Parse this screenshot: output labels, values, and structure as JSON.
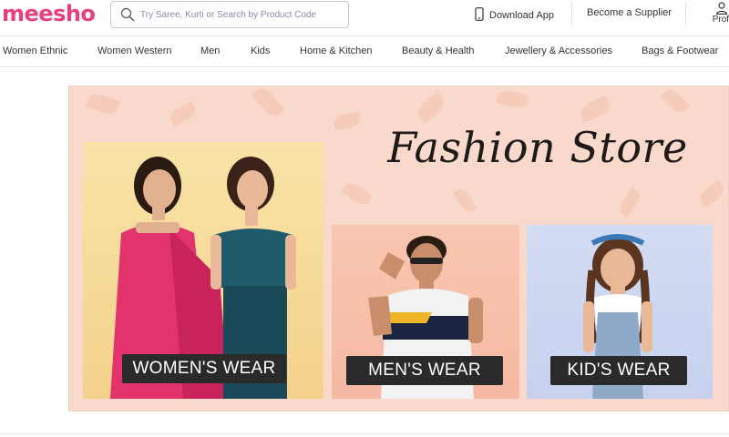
{
  "header": {
    "logo": "meesho",
    "search_placeholder": "Try Saree, Kurti or Search by Product Code",
    "download_app": "Download App",
    "become_supplier": "Become a Supplier",
    "profile": "Profi"
  },
  "nav": {
    "items": [
      {
        "label": "Women Ethnic"
      },
      {
        "label": "Women Western"
      },
      {
        "label": "Men"
      },
      {
        "label": "Kids"
      },
      {
        "label": "Home & Kitchen"
      },
      {
        "label": "Beauty & Health"
      },
      {
        "label": "Jewellery & Accessories"
      },
      {
        "label": "Bags & Footwear"
      }
    ]
  },
  "banner": {
    "title": "Fashion Store",
    "panels": [
      {
        "label": "WOMEN'S WEAR"
      },
      {
        "label": "MEN'S WEAR"
      },
      {
        "label": "KID'S WEAR"
      }
    ]
  },
  "colors": {
    "brand": "#e8407e",
    "banner_bg": "#f8d9cb",
    "label_bg": "#2a2a2a"
  }
}
